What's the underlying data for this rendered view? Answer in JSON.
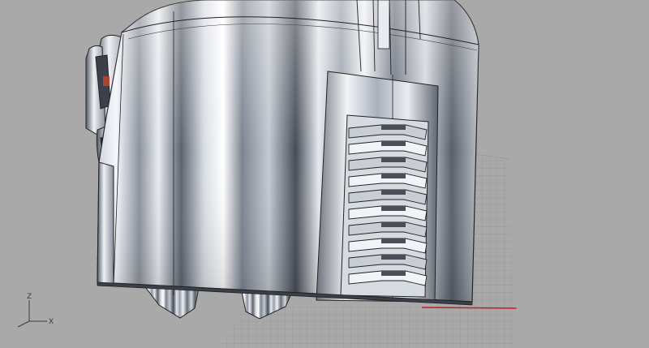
{
  "viewport": {
    "background": "#a9a9a9",
    "grid_color": "#8f8f8f",
    "x_axis_color": "#cc1f1f",
    "y_axis_color": "#2f8f2f"
  },
  "model": {
    "body_light": "#e6e8ee",
    "body_mid": "#9aa0ac",
    "body_dark": "#454a55",
    "edge_color": "#222222"
  },
  "axes_widget": {
    "z_label": "Z",
    "x_label": "X",
    "icon": "world-axes-icon"
  }
}
